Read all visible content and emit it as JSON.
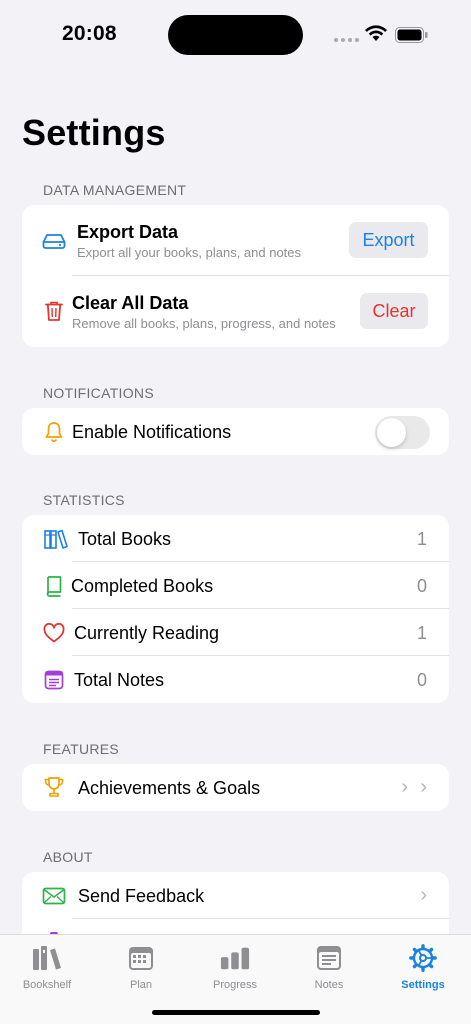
{
  "status_bar": {
    "time": "20:08"
  },
  "page_title": "Settings",
  "data_management": {
    "header": "DATA MANAGEMENT",
    "export": {
      "title": "Export Data",
      "subtitle": "Export all your books, plans, and notes",
      "button": "Export",
      "icon": "drive-icon",
      "color": "#1a82e2"
    },
    "clear": {
      "title": "Clear All Data",
      "subtitle": "Remove all books, plans, progress, and notes",
      "button": "Clear",
      "icon": "trash-icon",
      "color": "#e5342f"
    }
  },
  "notifications": {
    "header": "NOTIFICATIONS",
    "enable_label": "Enable Notifications",
    "enabled": false,
    "icon": "bell-icon"
  },
  "statistics": {
    "header": "STATISTICS",
    "items": [
      {
        "label": "Total Books",
        "value": "1",
        "icon": "books-icon"
      },
      {
        "label": "Completed Books",
        "value": "0",
        "icon": "book-icon"
      },
      {
        "label": "Currently Reading",
        "value": "1",
        "icon": "heart-icon"
      },
      {
        "label": "Total Notes",
        "value": "0",
        "icon": "notes-icon"
      }
    ]
  },
  "features": {
    "header": "FEATURES",
    "achievements_label": "Achievements & Goals",
    "icon": "trophy-icon"
  },
  "about": {
    "header": "ABOUT",
    "feedback_label": "Send Feedback",
    "icon": "envelope-icon"
  },
  "tab_bar": {
    "tabs": [
      {
        "label": "Bookshelf",
        "icon": "bookshelf-icon"
      },
      {
        "label": "Plan",
        "icon": "calendar-icon"
      },
      {
        "label": "Progress",
        "icon": "bar-chart-icon"
      },
      {
        "label": "Notes",
        "icon": "notes-tab-icon"
      },
      {
        "label": "Settings",
        "icon": "gear-icon"
      }
    ],
    "active": "Settings",
    "active_color": "#1a82e2"
  }
}
